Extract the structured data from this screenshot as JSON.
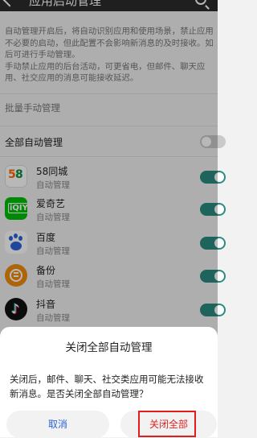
{
  "header": {
    "back_icon": "back-arrow-icon",
    "title": "应用启动管理",
    "search_icon": "search-icon",
    "background": "#2b2b2b"
  },
  "description": {
    "p1": "自动管理开启后，将自动识别应用和使用场景，禁止应用不必要的启动，但此配置不会影响新消息的及时接收。如需手动管理，请关闭后可进行手动管理。",
    "p1_display": "自动管理开启后，将自动识别应用和使用场景，禁止应用不必要的启动，但此配置不会影响新消息的及时接收。如后可进行手动管理。",
    "p2": "手动禁止应用的后台活动，可更省电，但邮件、聊天应用、社交应用的消息可能接收延迟。"
  },
  "section": {
    "label": "批量手动管理"
  },
  "all_auto": {
    "label": "全部自动管理",
    "switch_on": false
  },
  "apps": [
    {
      "name": "58同城",
      "status": "自动管理",
      "icon": "58-tongcheng-icon",
      "switch_on": true
    },
    {
      "name": "爱奇艺",
      "status": "自动管理",
      "icon": "iqiyi-icon",
      "switch_on": true
    },
    {
      "name": "百度",
      "status": "自动管理",
      "icon": "baidu-icon",
      "switch_on": true
    },
    {
      "name": "备份",
      "status": "自动管理",
      "icon": "backup-icon",
      "switch_on": true
    },
    {
      "name": "抖音",
      "status": "自动管理",
      "icon": "douyin-icon",
      "switch_on": true
    }
  ],
  "dialog": {
    "title": "关闭全部自动管理",
    "message": "关闭后，邮件、聊天、社交类应用可能无法接收新消息。是否关闭全部自动管理？",
    "cancel_label": "取消",
    "confirm_label": "关闭全部"
  },
  "colors": {
    "accent": "#2c8a82",
    "confirm_text": "#dd2222",
    "cancel_text": "#2b63d9",
    "highlight_border": "#e21d1d"
  }
}
